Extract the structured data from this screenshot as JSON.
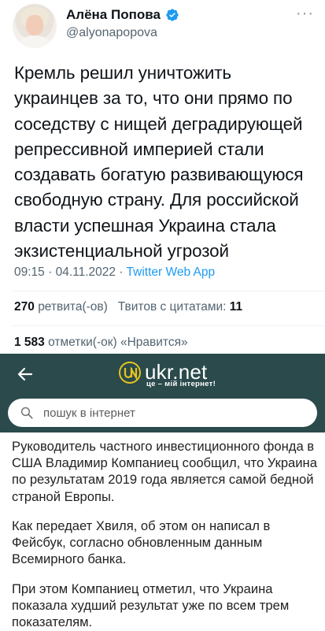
{
  "tweet": {
    "author_name": "Алёна Попова",
    "handle": "@alyonapopova",
    "text": "Кремль решил уничтожить\nукраинцев за то, что они прямо по\nсоседству с нищей деградирующей\nрепрессивной империей стали\nсоздавать богатую развивающуюся\nсвободную страну. Для российской\nвласти успешная Украина стала\nэкзистенциальной угрозой",
    "time": "09:15",
    "date": "04.11.2022",
    "separator": "·",
    "app": "Twitter Web App",
    "retweets_count": "270",
    "retweets_label": "ретвита(-ов)",
    "quotes_label": "Твитов с цитатами:",
    "quotes_count": "11",
    "likes_count": "1 583",
    "likes_label": "отметки(-ок) «Нравится»",
    "more_icon": "more-dots-icon",
    "verified_color": "#1d9bf0",
    "link_color": "#1d9bf0"
  },
  "ukrnet": {
    "logo_text": "ukr.net",
    "tagline": "це – мій інтернет!",
    "search_placeholder": "пошук в інтернет",
    "header_color": "#2a4a4b",
    "logo_accent": "#e6c320"
  },
  "article": {
    "paragraphs": [
      "Руководитель частного инвестиционного фонда в США Владимир Компаниец сообщил, что Украина по результатам 2019 года является самой бедной страной Европы.",
      "Как передает Хвиля, об этом он написал в Фейсбук, согласно обновленным данным Всемирного банка.",
      "При этом Компаниец отметил, что Украина показала худший результат уже по всем трем показателям."
    ]
  }
}
